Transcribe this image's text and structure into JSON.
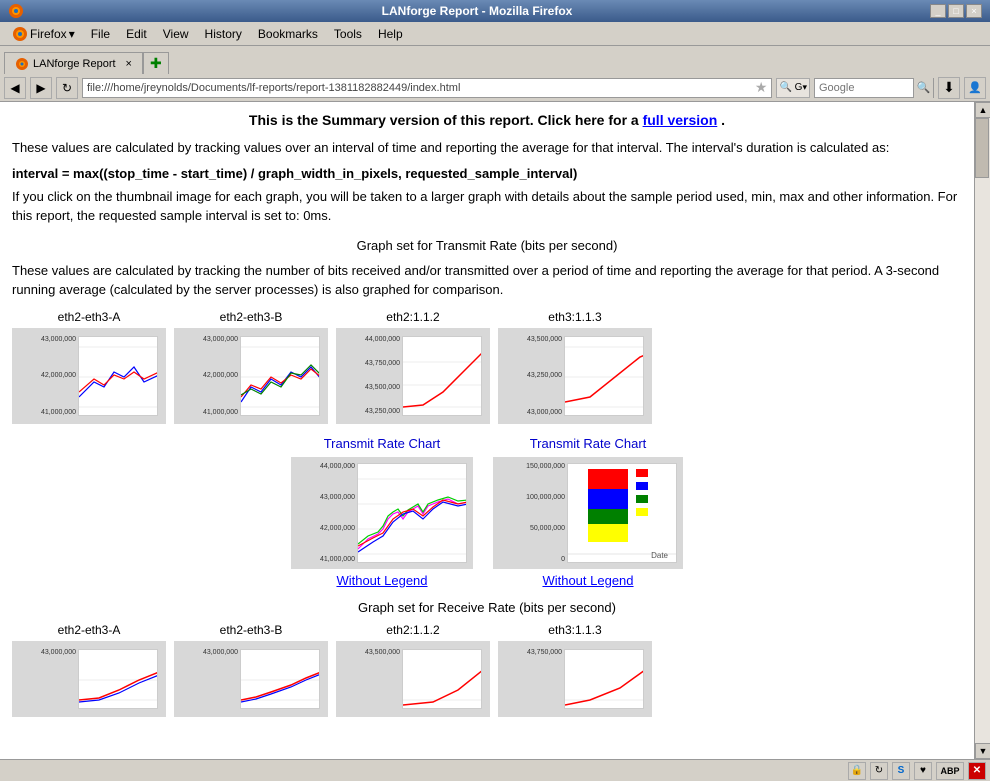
{
  "browser": {
    "title": "LANforge Report - Mozilla Firefox",
    "menu_items": [
      "Firefox",
      "File",
      "Edit",
      "View",
      "History",
      "Bookmarks",
      "Tools",
      "Help"
    ],
    "tab_label": "LANforge Report",
    "address": "file:///home/jreynolds/Documents/lf-reports/report-1381182882449/index.html",
    "search_placeholder": "Google",
    "nav_buttons": [
      "◀",
      "▶",
      "↻"
    ]
  },
  "content": {
    "summary_title_prefix": "This is the Summary version of this report. Click here for a ",
    "full_version_link": "full version",
    "summary_title_suffix": ".",
    "description1": "These values are calculated by tracking values over an interval of time and reporting the average for that interval. The interval's duration is calculated as:",
    "formula": "interval = max((stop_time - start_time) / graph_width_in_pixels, requested_sample_interval)",
    "description2": "If you click on the thumbnail image for each graph, you will be taken to a larger graph with details about the sample period used, min, max and other information. For this report, the requested sample interval is set to: 0ms.",
    "transmit_graph_title": "Graph set for Transmit Rate (bits per second)",
    "transmit_description": "These values are calculated by tracking the number of bits received and/or transmitted over a period of time and reporting the average for that period. A 3-second running average (calculated by the server processes) is also graphed for comparison.",
    "thumbnail_graphs": [
      {
        "label": "eth2-eth3-A",
        "y_values": [
          "43,000,000",
          "42,000,000",
          "41,000,000"
        ]
      },
      {
        "label": "eth2-eth3-B",
        "y_values": [
          "43,000,000",
          "42,000,000",
          "41,000,000"
        ]
      },
      {
        "label": "eth2:1.1.2",
        "y_values": [
          "44,000,000",
          "43,750,000",
          "43,500,000",
          "43,250,000"
        ]
      },
      {
        "label": "eth3:1.1.3",
        "y_values": [
          "43,500,000",
          "43,250,000",
          "43,000,000"
        ]
      }
    ],
    "large_charts": [
      {
        "title": "Transmit Rate Chart",
        "without_legend": "Without Legend",
        "type": "line",
        "y_values": [
          "44,000,000",
          "43,000,000",
          "42,000,000",
          "41,000,000"
        ]
      },
      {
        "title": "Transmit Rate Chart",
        "without_legend": "Without Legend",
        "type": "bar",
        "y_values": [
          "150,000,000",
          "100,000,000",
          "50,000,000",
          "0"
        ],
        "x_label": "Date"
      }
    ],
    "receive_graph_title": "Graph set for Receive Rate (bits per second)",
    "receive_thumbnails": [
      {
        "label": "eth2-eth3-A",
        "y_values": [
          "43,000,000"
        ]
      },
      {
        "label": "eth2-eth3-B",
        "y_values": [
          "43,000,000"
        ]
      },
      {
        "label": "eth2:1.1.2",
        "y_values": [
          "43,500,000"
        ]
      },
      {
        "label": "eth3:1.1.3",
        "y_values": [
          "43,750,000"
        ]
      }
    ]
  },
  "status_bar": {
    "icons": [
      "🔒",
      "↻",
      "S",
      "♥",
      "ABP",
      "✕"
    ]
  }
}
